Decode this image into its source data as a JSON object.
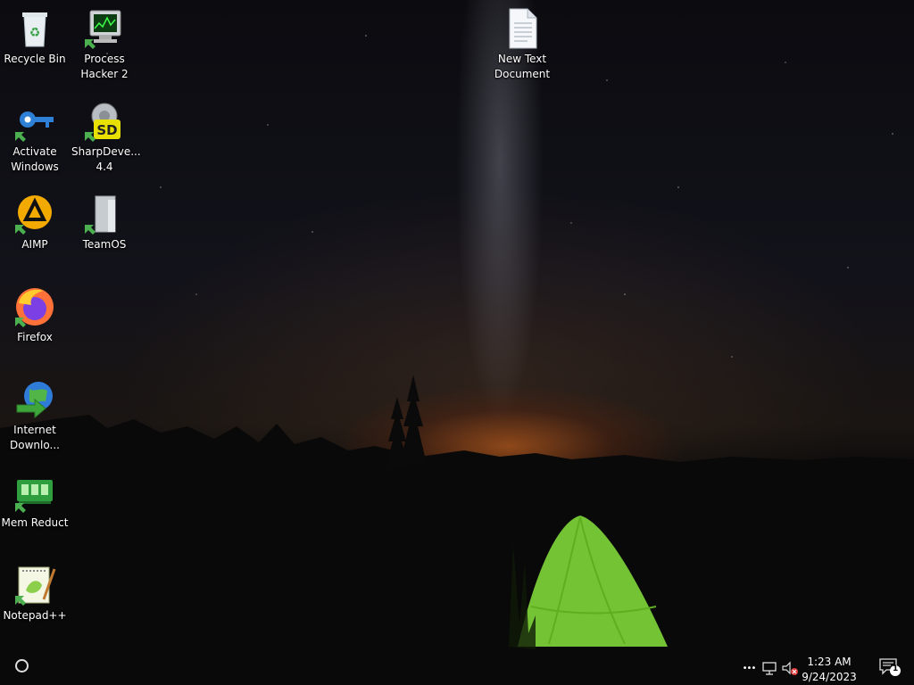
{
  "desktop_icons": [
    {
      "label": "Recycle Bin",
      "icon": "recycle-bin-icon"
    },
    {
      "label": "Process Hacker 2",
      "icon": "process-hacker-icon"
    },
    {
      "label": "New Text Document",
      "icon": "text-document-icon"
    },
    {
      "label": "Activate Windows",
      "icon": "key-icon"
    },
    {
      "label": "SharpDeve... 4.4",
      "icon": "sharpdevelop-icon"
    },
    {
      "label": "AIMP",
      "icon": "aimp-icon"
    },
    {
      "label": "TeamOS",
      "icon": "teamos-icon"
    },
    {
      "label": "Firefox",
      "icon": "firefox-icon"
    },
    {
      "label": "Internet Downlo...",
      "icon": "internet-download-icon"
    },
    {
      "label": "Mem Reduct",
      "icon": "mem-reduct-icon"
    },
    {
      "label": "Notepad++",
      "icon": "notepadpp-icon"
    }
  ],
  "taskbar": {
    "time": "1:23 AM",
    "date": "9/24/2023",
    "notification_count": "1",
    "tray_overflow": "•••"
  },
  "colors": {
    "tent_green": "#7fd83a",
    "horizon_glow": "#e8702a"
  }
}
